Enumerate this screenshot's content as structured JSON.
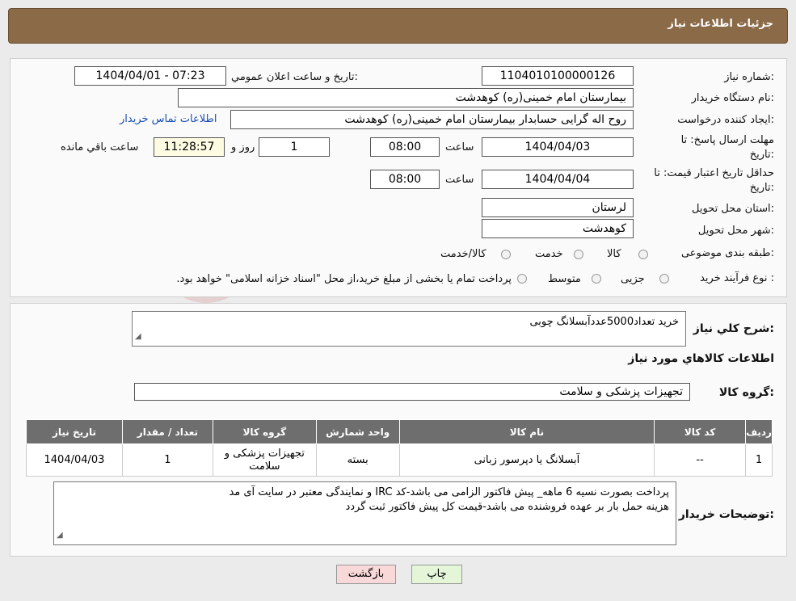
{
  "header": {
    "title": "جزئیات اطلاعات نیاز"
  },
  "form": {
    "need_number_label": "شماره نیاز:",
    "need_number": "1104010100000126",
    "announce_label": "تاریخ و ساعت اعلان عمومي:",
    "announce_value": "1404/04/01 - 07:23",
    "buyer_org_label": "نام دستگاه خريدار:",
    "buyer_org": "بیمارستان امام خمینی(ره) کوهدشت",
    "creator_label": "ايجاد كننده درخواست:",
    "creator": "روح اله گرایی حسابدار بیمارستان امام خمینی(ره) کوهدشت",
    "contact_link": "اطلاعات تماس خريدار",
    "reply_deadline_label_1": "مهلت ارسال پاسخ: تا",
    "reply_deadline_label_2": "تاريخ:",
    "reply_date": "1404/04/03",
    "time_label": "ساعت",
    "reply_time": "08:00",
    "days": "1",
    "days_label": "روز و",
    "remaining_time": "11:28:57",
    "remaining_label": "ساعت باقي مانده",
    "price_validity_label_1": "حداقل تاريخ اعتبار قيمت: تا",
    "price_validity_label_2": "تاريخ:",
    "validity_date": "1404/04/04",
    "validity_time": "08:00",
    "province_label": "استان محل تحويل:",
    "province": "لرستان",
    "city_label": "شهر محل تحويل:",
    "city": "کوهدشت",
    "category_label": "طبقه بندی موضوعی:",
    "category_options": [
      "کالا",
      "خدمت",
      "کالا/خدمت"
    ],
    "process_label": "نوع فرآيند خريد :",
    "process_options": [
      "جزیی",
      "متوسط"
    ],
    "process_note": "پرداخت تمام يا بخشی از مبلغ خريد،از محل \"اسناد خزانه اسلامی\" خواهد بود."
  },
  "summary": {
    "label": "شرح كلي نياز:",
    "text": "خرید تعداد5000عددآبسلانگ چوبی",
    "items_title": "اطلاعات كالاهاي مورد نياز",
    "group_label": "گروه كالا:",
    "group_value": "تجهیزات پزشکی و سلامت"
  },
  "table": {
    "headers": [
      "رديف",
      "كد كالا",
      "نام كالا",
      "واحد شمارش",
      "گروه كالا",
      "تعداد / مقدار",
      "تاريخ نياز"
    ],
    "rows": [
      [
        "1",
        "--",
        "آبسلانگ یا دپرسور زبانی",
        "بسته",
        "تجهیزات پزشکی و سلامت",
        "1",
        "1404/04/03"
      ]
    ]
  },
  "buyer_notes": {
    "label": "توضيحات خريدار:",
    "line1": "پرداخت بصورت نسیه 6 ماهه_ پیش فاکتور  الزامی می باشد-کد IRC و نمایندگی معتبر در سایت آی مد",
    "line2": "هزینه حمل بار بر عهده فروشنده می باشد-قیمت کل پیش فاکتور ثبت گردد"
  },
  "buttons": {
    "print": "چاپ",
    "back": "بازگشت"
  },
  "colors": {
    "header": "#8b6a47",
    "table_header": "#6e6e6e",
    "back_button": "#f8d8d8",
    "print_button": "#e4f5d8"
  }
}
